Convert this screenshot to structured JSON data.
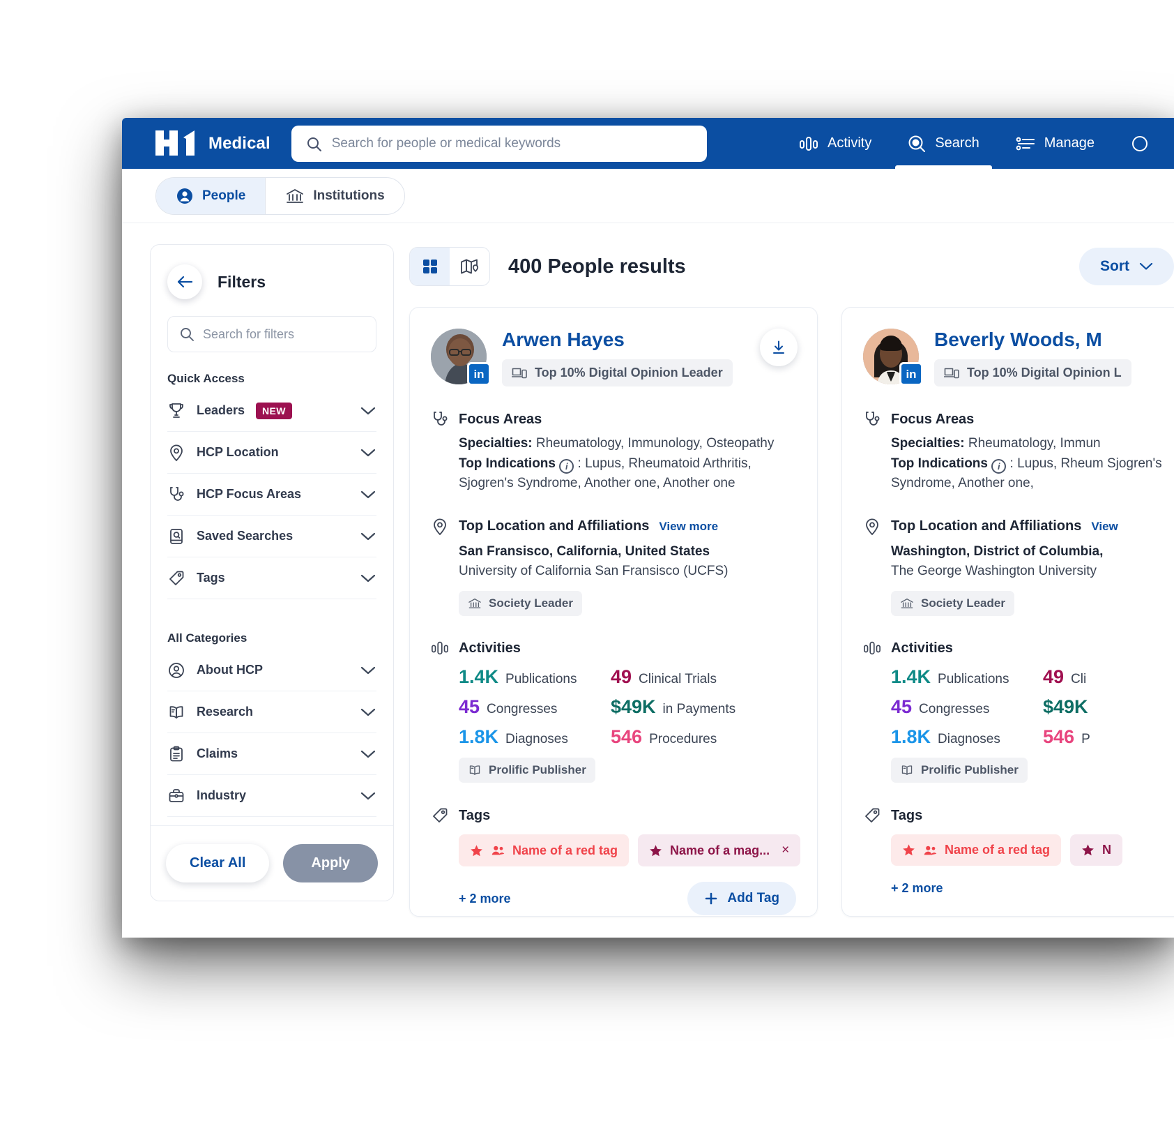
{
  "topbar": {
    "logo_text": "H1",
    "brand": "Medical",
    "search_placeholder": "Search for people or medical keywords",
    "search_value": "",
    "nav": [
      {
        "label": "Activity",
        "icon": "activity-bars-icon",
        "active": false
      },
      {
        "label": "Search",
        "icon": "search-icon",
        "active": true
      },
      {
        "label": "Manage",
        "icon": "list-settings-icon",
        "active": false
      }
    ]
  },
  "tabs": [
    {
      "label": "People",
      "icon": "person-icon",
      "active": true
    },
    {
      "label": "Institutions",
      "icon": "institution-icon",
      "active": false
    }
  ],
  "filters": {
    "title": "Filters",
    "back_icon": "arrow-left-icon",
    "search_placeholder": "Search for filters",
    "search_value": "",
    "quick_access_label": "Quick Access",
    "quick_access": [
      {
        "label": "Leaders",
        "icon": "trophy-icon",
        "badge": "NEW"
      },
      {
        "label": "HCP Location",
        "icon": "location-pin-icon",
        "badge": ""
      },
      {
        "label": "HCP Focus Areas",
        "icon": "stethoscope-icon",
        "badge": ""
      },
      {
        "label": "Saved Searches",
        "icon": "saved-search-icon",
        "badge": ""
      },
      {
        "label": "Tags",
        "icon": "tag-icon",
        "badge": ""
      }
    ],
    "all_categories_label": "All Categories",
    "all_categories": [
      {
        "label": "About HCP",
        "icon": "user-circle-icon"
      },
      {
        "label": "Research",
        "icon": "book-icon"
      },
      {
        "label": "Claims",
        "icon": "clipboard-icon"
      },
      {
        "label": "Industry",
        "icon": "briefcase-icon"
      }
    ],
    "clear_label": "Clear All",
    "apply_label": "Apply"
  },
  "results": {
    "count_text": "400 People results",
    "view_grid_icon": "grid-view-icon",
    "view_map_icon": "map-view-icon",
    "sort_label": "Sort",
    "sort_icon": "chevron-down-icon"
  },
  "cards": [
    {
      "name": "Arwen Hayes",
      "linkedin_icon": "linkedin-icon",
      "dol_badge": "Top 10% Digital Opinion Leader",
      "dol_icon": "devices-icon",
      "download_icon": "download-icon",
      "focus_title": "Focus Areas",
      "focus_icon": "stethoscope-icon",
      "specialties_label": "Specialties:",
      "specialties_value": "Rheumatology, Immunology, Osteopathy",
      "indications_label": "Top Indications",
      "indications_value": ": Lupus, Rheumatoid Arthritis, Sjogren's Syndrome, Another one, Another one",
      "location_title": "Top Location and Affiliations",
      "location_icon": "location-pin-icon",
      "view_more": "View more",
      "location_line": "San Fransisco, California, United States",
      "affiliation_line": "University of California San Fransisco (UCFS)",
      "society_chip": "Society Leader",
      "society_icon": "institution-icon",
      "activities_title": "Activities",
      "activities_icon": "activity-bars-icon",
      "stats": [
        {
          "num": "1.4K",
          "label": "Publications",
          "color": "#0f8a86"
        },
        {
          "num": "49",
          "label": "Clinical Trials",
          "color": "#a01050"
        },
        {
          "num": "45",
          "label": "Congresses",
          "color": "#7b2ad1"
        },
        {
          "num": "$49K",
          "label": "in Payments",
          "color": "#0e6e64"
        },
        {
          "num": "1.8K",
          "label": "Diagnoses",
          "color": "#1b95e8"
        },
        {
          "num": "546",
          "label": "Procedures",
          "color": "#e8457e"
        }
      ],
      "publisher_chip": "Prolific Publisher",
      "publisher_icon": "book-icon",
      "tags_title": "Tags",
      "tags_icon": "tag-icon",
      "tags": [
        {
          "label": "Name of a red tag",
          "style": "red",
          "star": "star-icon",
          "people": "people-icon",
          "close": ""
        },
        {
          "label": "Name of a mag...",
          "style": "magenta",
          "star": "star-icon",
          "people": "",
          "close": "×"
        }
      ],
      "more_tags": "+ 2 more",
      "add_tag": "Add Tag",
      "add_tag_icon": "plus-icon"
    },
    {
      "name": "Beverly Woods, M",
      "linkedin_icon": "linkedin-icon",
      "dol_badge": "Top 10% Digital Opinion L",
      "dol_icon": "devices-icon",
      "download_icon": "download-icon",
      "focus_title": "Focus Areas",
      "focus_icon": "stethoscope-icon",
      "specialties_label": "Specialties:",
      "specialties_value": "Rheumatology, Immun",
      "indications_label": "Top Indications",
      "indications_value": ": Lupus, Rheum Sjogren's Syndrome, Another one,",
      "location_title": "Top Location and Affiliations",
      "location_icon": "location-pin-icon",
      "view_more": "View",
      "location_line": "Washington, District of Columbia,",
      "affiliation_line": "The George Washington University",
      "society_chip": "Society Leader",
      "society_icon": "institution-icon",
      "activities_title": "Activities",
      "activities_icon": "activity-bars-icon",
      "stats": [
        {
          "num": "1.4K",
          "label": "Publications",
          "color": "#0f8a86"
        },
        {
          "num": "49",
          "label": "Cli",
          "color": "#a01050"
        },
        {
          "num": "45",
          "label": "Congresses",
          "color": "#7b2ad1"
        },
        {
          "num": "$49K",
          "label": "",
          "color": "#0e6e64"
        },
        {
          "num": "1.8K",
          "label": "Diagnoses",
          "color": "#1b95e8"
        },
        {
          "num": "546",
          "label": "P",
          "color": "#e8457e"
        }
      ],
      "publisher_chip": "Prolific Publisher",
      "publisher_icon": "book-icon",
      "tags_title": "Tags",
      "tags_icon": "tag-icon",
      "tags": [
        {
          "label": "Name of a red tag",
          "style": "red",
          "star": "star-icon",
          "people": "people-icon",
          "close": ""
        },
        {
          "label": "N",
          "style": "magenta",
          "star": "star-icon",
          "people": "",
          "close": ""
        }
      ],
      "more_tags": "+ 2 more",
      "add_tag": "",
      "add_tag_icon": ""
    }
  ],
  "colors": {
    "brand_blue": "#0b4ea2",
    "accent_light": "#eaf1fb",
    "new_badge": "#9c1150"
  }
}
